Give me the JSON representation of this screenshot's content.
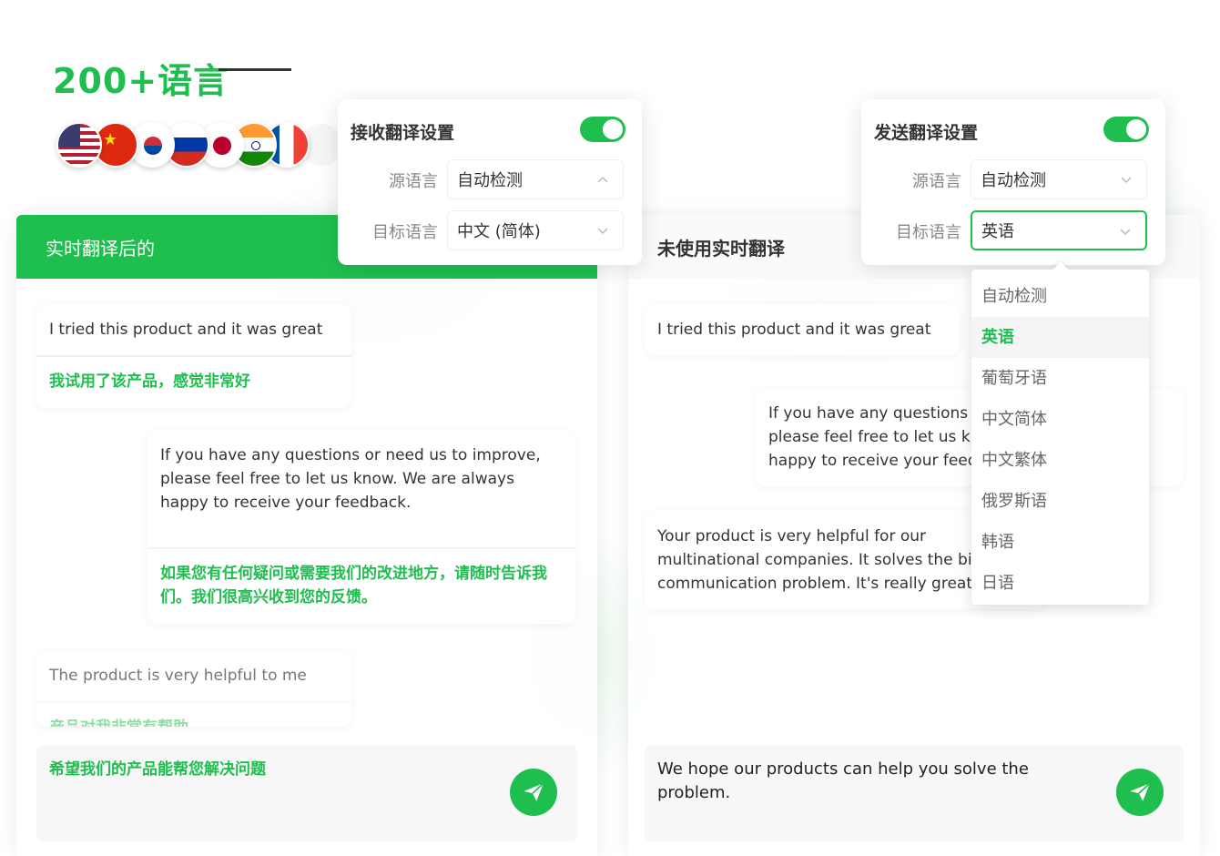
{
  "headline": "200+语言",
  "flags": [
    "us-flag",
    "cn-flag",
    "kr-flag",
    "ru-flag",
    "jp-flag",
    "in-flag",
    "fr-flag"
  ],
  "accent_color": "#1fbf4f",
  "left_panel": {
    "title": "实时翻译后的",
    "messages": [
      {
        "original": "I tried this product and it was great",
        "translation": "我试用了该产品，感觉非常好"
      },
      {
        "original": "If you have any questions or need us to improve, please feel free to let us know. We are always happy to receive your feedback.",
        "translation": "如果您有任何疑问或需要我们的改进地方，请随时告诉我们。我们很高兴收到您的反馈。"
      },
      {
        "original": "The product is very helpful to me",
        "translation": "产品对我非常有帮助"
      }
    ],
    "input_text": "希望我们的产品能帮您解决问题"
  },
  "right_panel": {
    "title": "未使用实时翻译",
    "messages": [
      {
        "original": "I tried this product and it was great"
      },
      {
        "original": "If you have any questions or need us to improve, please feel free to let us know. We are always happy to receive your feedback."
      },
      {
        "original": "Your product is very helpful for our multinational companies. It solves the biggest communication problem. It's really great."
      }
    ],
    "input_text": "We hope our products can help you solve the problem."
  },
  "receive_settings": {
    "title": "接收翻译设置",
    "enabled": true,
    "source_label": "源语言",
    "source_value": "自动检测",
    "target_label": "目标语言",
    "target_value": "中文 (简体)"
  },
  "send_settings": {
    "title": "发送翻译设置",
    "enabled": true,
    "source_label": "源语言",
    "source_value": "自动检测",
    "target_label": "目标语言",
    "target_value": "英语"
  },
  "language_options": [
    "自动检测",
    "英语",
    "葡萄牙语",
    "中文简体",
    "中文繁体",
    "俄罗斯语",
    "韩语",
    "日语"
  ],
  "selected_language": "英语"
}
